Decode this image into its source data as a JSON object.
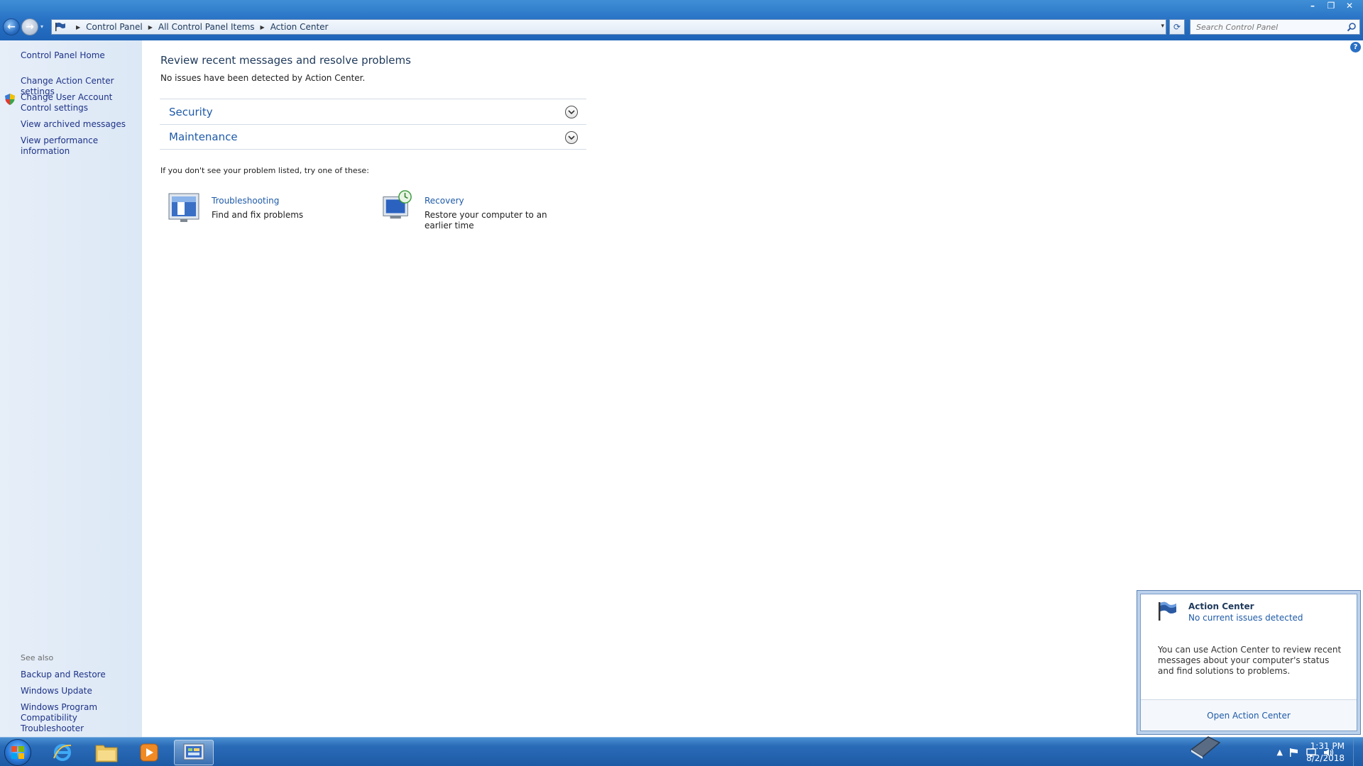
{
  "window": {
    "minimize_glyph": "–",
    "maximize_glyph": "❐",
    "close_glyph": "✕"
  },
  "nav": {
    "back_glyph": "←",
    "forward_glyph": "→",
    "dropdown_glyph": "▾"
  },
  "breadcrumb": {
    "items": [
      "Control Panel",
      "All Control Panel Items",
      "Action Center"
    ],
    "sep_glyph": "▶",
    "arrow_glyph": "▾"
  },
  "refresh_glyph": "⟳",
  "search": {
    "placeholder": "Search Control Panel"
  },
  "help_glyph": "?",
  "left_pane": {
    "home": "Control Panel Home",
    "links": [
      "Change Action Center settings",
      "Change User Account Control settings",
      "View archived messages",
      "View performance information"
    ],
    "see_also_label": "See also",
    "see_also_links": [
      "Backup and Restore",
      "Windows Update",
      "Windows Program Compatibility Troubleshooter"
    ]
  },
  "main": {
    "title": "Review recent messages and resolve problems",
    "status": "No issues have been detected by Action Center.",
    "sections": [
      "Security",
      "Maintenance"
    ],
    "hint": "If you don't see your problem listed, try one of these:",
    "tools": [
      {
        "label": "Troubleshooting",
        "desc": "Find and fix problems"
      },
      {
        "label": "Recovery",
        "desc": "Restore your computer to an earlier time"
      }
    ]
  },
  "popup": {
    "title": "Action Center",
    "subtitle": "No current issues detected",
    "body": "You can use Action Center to review recent messages about your computer's status and find solutions to problems.",
    "link": "Open Action Center"
  },
  "taskbar": {
    "tray_arrow_glyph": "▲",
    "time": "1:31 PM",
    "date": "8/2/2018"
  },
  "colors": {
    "link": "#1e5aa8",
    "title_text": "#1e395b",
    "left_pane_bg": "#dce8f6",
    "taskbar": "#1d5aa5"
  }
}
